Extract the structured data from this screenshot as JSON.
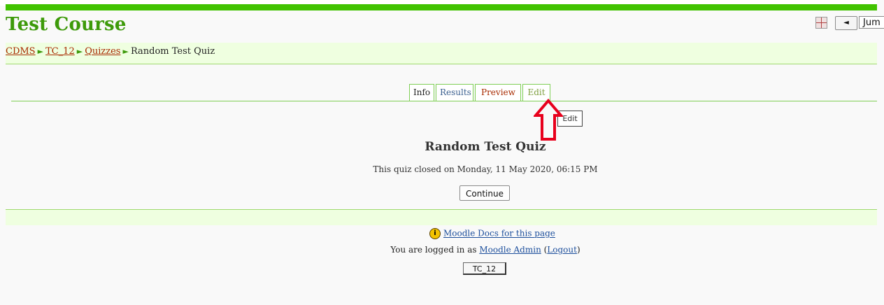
{
  "header": {
    "course_title": "Test Course",
    "jump_label": "Jum",
    "prev_label": "◄"
  },
  "breadcrumb": {
    "items": [
      "CDMS",
      "TC_12",
      "Quizzes"
    ],
    "separator": "►",
    "current": "Random Test Quiz"
  },
  "tabs": [
    "Info",
    "Results",
    "Preview",
    "Edit"
  ],
  "tooltip": "Edit",
  "quiz": {
    "title": "Random Test Quiz",
    "closed_message": "This quiz closed on Monday, 11 May 2020, 06:15 PM",
    "continue_label": "Continue"
  },
  "footer": {
    "docs_link": "Moodle Docs for this page",
    "login_prefix": "You are logged in as ",
    "user_name": "Moodle Admin",
    "logout_open": " (",
    "logout_label": "Logout",
    "logout_close": ")",
    "home_button": "TC_12"
  },
  "colors": {
    "top_bar": "#41c300",
    "course_title": "#3d9a0a",
    "navbar_bg": "#efffe0",
    "link": "#a82a00",
    "arrow": "#e8001c"
  }
}
